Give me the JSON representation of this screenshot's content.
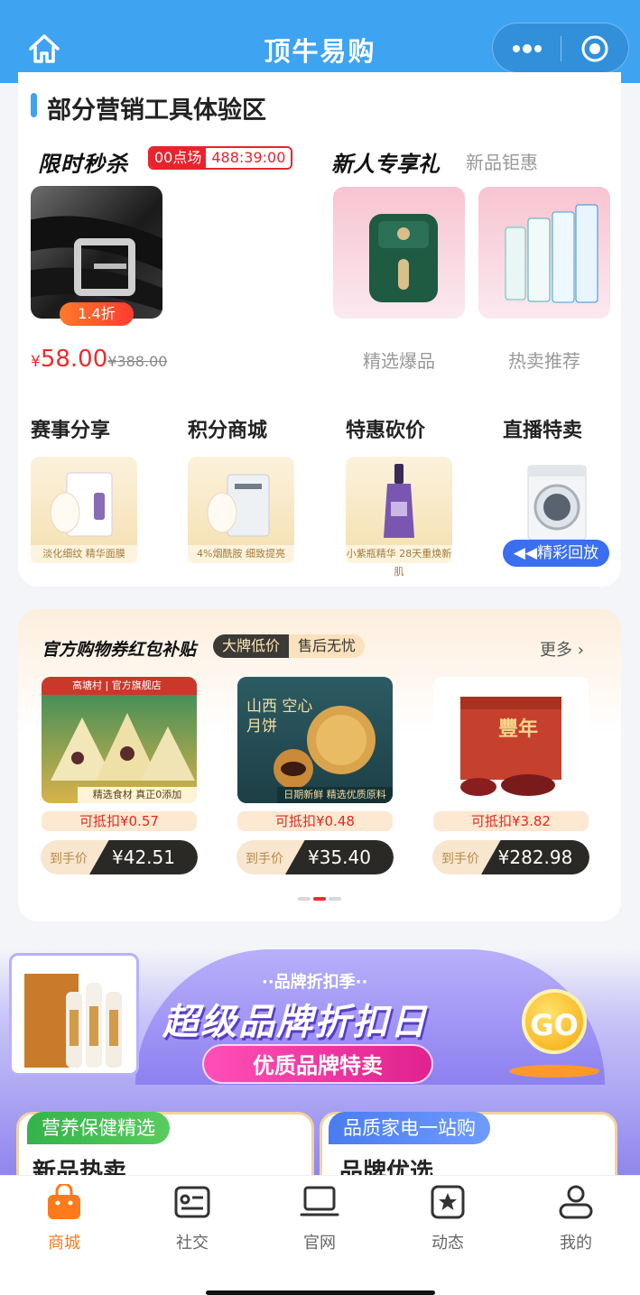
{
  "app": {
    "title": "顶牛易购"
  },
  "section": {
    "title": "部分营销工具体验区"
  },
  "flash_sale": {
    "title": "限时秒杀",
    "session": "00点场",
    "countdown": "488:39:00",
    "discount": "1.4折",
    "price_symbol": "¥",
    "price": "58.00",
    "old_price": "¥388.00"
  },
  "newcomer": {
    "title": "新人专享礼",
    "subtitle": "新品钜惠",
    "items": [
      {
        "label": "精选爆品"
      },
      {
        "label": "热卖推荐"
      }
    ]
  },
  "categories": [
    {
      "title": "赛事分享",
      "caption": "淡化细纹 精华面膜"
    },
    {
      "title": "积分商城",
      "caption": "4%烟酰胺 细致提亮"
    },
    {
      "title": "特惠砍价",
      "caption": "小紫瓶精华 28天重焕新肌"
    },
    {
      "title": "直播特卖",
      "caption": "精彩回放"
    }
  ],
  "coupon": {
    "title": "官方购物券红包补贴",
    "pill_a": "大牌低价",
    "pill_b": "售后无忧",
    "more": "更多",
    "final_label": "到手价",
    "products": [
      {
        "deduct": "可抵扣¥0.57",
        "price": "¥42.51",
        "brand": "高塘村 | 官方旗舰店",
        "caption": "精选食材 真正0添加"
      },
      {
        "deduct": "可抵扣¥0.48",
        "price": "¥35.40",
        "brand": "山西 空心月饼",
        "caption": "日期新鲜 精选优质原料"
      },
      {
        "deduct": "可抵扣¥3.82",
        "price": "¥282.98",
        "brand": "豐年",
        "caption": ""
      }
    ]
  },
  "brand_banner": {
    "small": "··品牌折扣季··",
    "big": "超级品牌折扣日",
    "button": "优质品牌特卖",
    "go": "GO"
  },
  "sub_cards": [
    {
      "tag": "营养保健精选",
      "big": "新品热卖"
    },
    {
      "tag": "品质家电一站购",
      "big": "品牌优选"
    }
  ],
  "tabs": [
    {
      "label": "商城",
      "icon": "shop-bag-icon"
    },
    {
      "label": "社交",
      "icon": "id-card-icon"
    },
    {
      "label": "官网",
      "icon": "laptop-icon"
    },
    {
      "label": "动态",
      "icon": "star-note-icon"
    },
    {
      "label": "我的",
      "icon": "user-icon"
    }
  ],
  "colors": {
    "primary": "#3ea3f1",
    "accent": "#ff7a1a",
    "price": "#ee2b2b"
  }
}
